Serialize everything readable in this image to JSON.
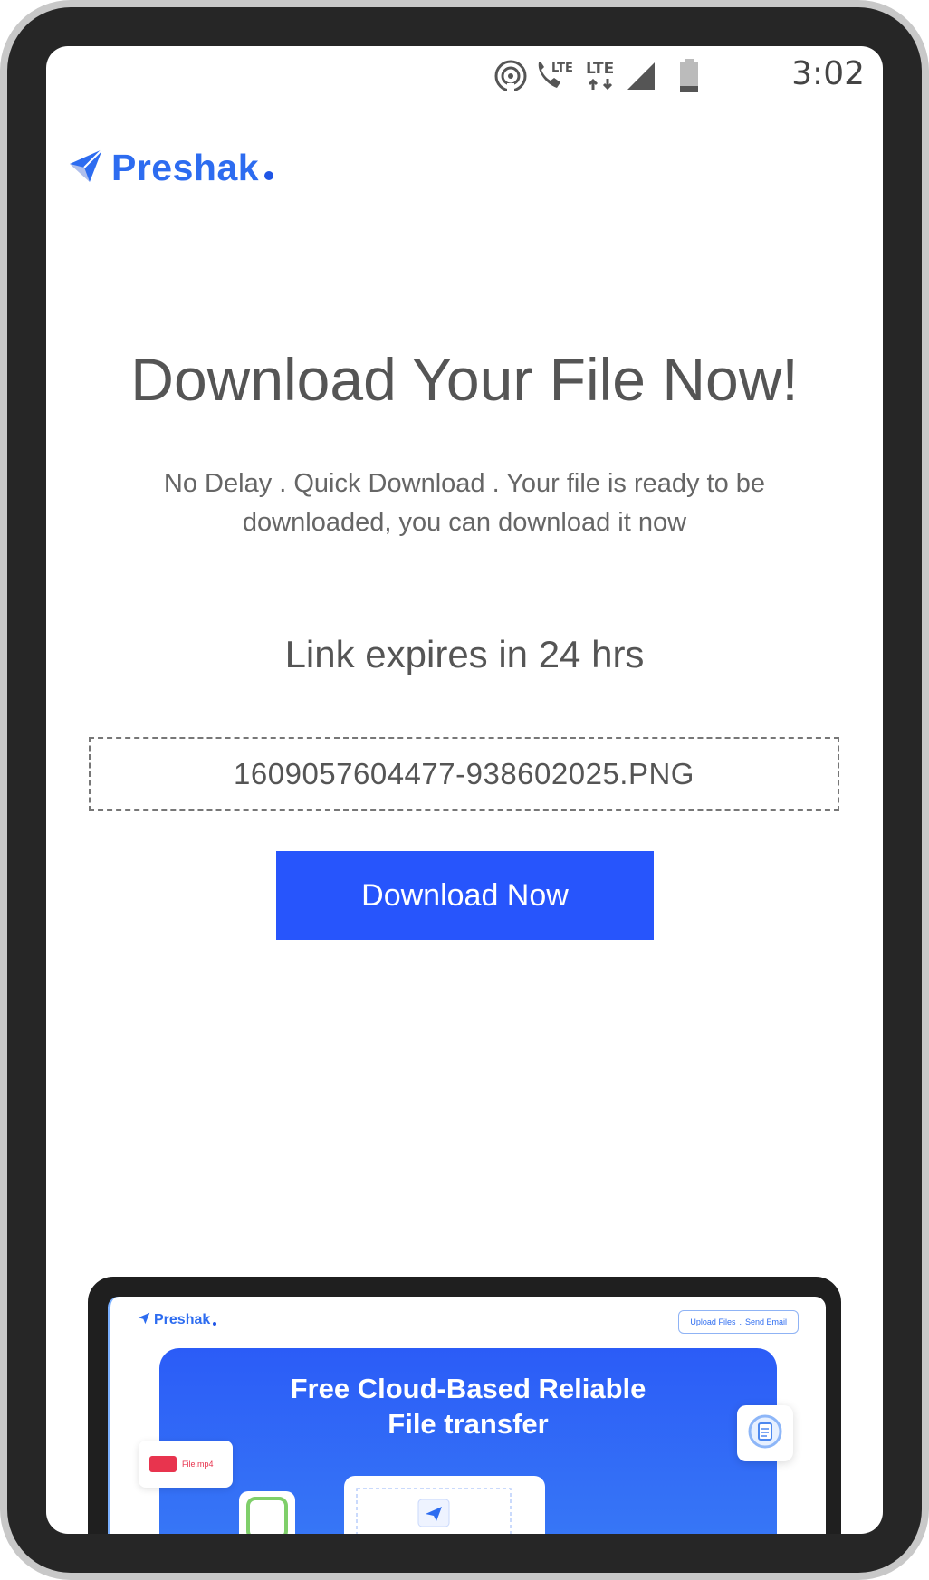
{
  "status_bar": {
    "time": "3:02",
    "icons": [
      "hotspot-icon",
      "volte-call-icon",
      "lte-data-icon",
      "signal-icon",
      "battery-icon"
    ],
    "lte_label": "LTE"
  },
  "brand": {
    "name": "Preshak",
    "color": "#2d6cf0"
  },
  "main": {
    "headline": "Download Your File Now!",
    "subtitle": "No Delay . Quick Download . Your file is ready to be downloaded, you can download it now",
    "expiry": "Link expires in 24 hrs",
    "filename": "1609057604477-938602025.PNG",
    "download_label": "Download Now",
    "button_color": "#2755fc"
  },
  "mockup": {
    "logo": "Preshak",
    "nav_upload": "Upload Files",
    "nav_separator": ".",
    "nav_email": "Send Email",
    "hero_title_line1": "Free Cloud-Based Reliable",
    "hero_title_line2": "File transfer",
    "file_label": "File.mp4"
  }
}
